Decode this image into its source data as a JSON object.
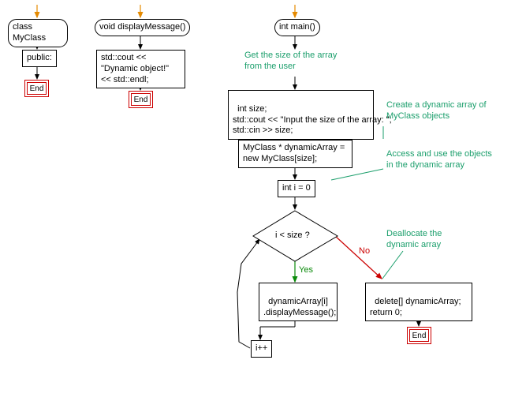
{
  "flow1": {
    "start_label": "class MyClass",
    "step1": "public:",
    "end": "End"
  },
  "flow2": {
    "start_label": "void displayMessage()",
    "step1": "std::cout << \"Dynamic object!\" << std::endl;",
    "end": "End"
  },
  "flow3": {
    "start_label": "int main()",
    "comment1": "Get the size of the array from the user",
    "step1": "int size;\nstd::cout << \"Input the size of the array: \";\nstd::cin >> size;",
    "comment2": "Create a dynamic array of MyClass objects",
    "step2": "MyClass * dynamicArray = new MyClass[size];",
    "comment3": "Access and use the objects in the dynamic array",
    "loop_init": "int i = 0",
    "cond": "i < size ?",
    "yes": "Yes",
    "no": "No",
    "comment4": "Deallocate the dynamic array",
    "loop_body": "dynamicArray[i]\n.displayMessage();",
    "loop_inc": "i++",
    "after_no": "delete[] dynamicArray;\nreturn 0;",
    "end": "End"
  }
}
